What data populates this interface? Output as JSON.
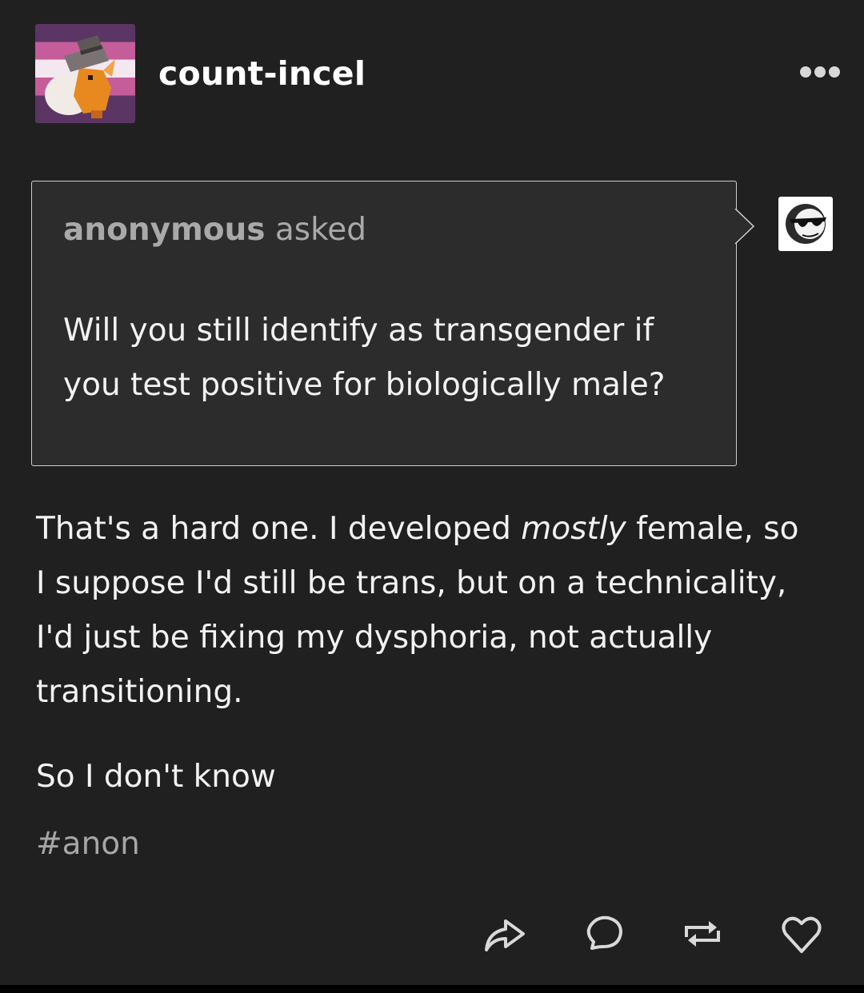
{
  "header": {
    "blog_name": "count-incel",
    "avatar_icon": "pixel-art-fox-with-hat-avatar",
    "more_icon": "more-dots-icon"
  },
  "ask": {
    "asker_name": "anonymous",
    "asked_label": "asked",
    "question_lines": [
      "Will you still identify as transgender if",
      "you test positive for biologically male?"
    ],
    "asker_avatar_icon": "sunglasses-face-icon"
  },
  "answer": {
    "line1_before": "That's a hard one. I developed ",
    "line1_emphasis": "mostly",
    "line1_after": " female, so",
    "line2": "I suppose I'd still be trans, but on a technicality,",
    "line3": "I'd just be fixing my dysphoria, not actually",
    "line4": "transitioning.",
    "paragraph2": "So I don't know"
  },
  "tags": [
    "#anon"
  ],
  "actions": {
    "share_icon": "share-icon",
    "reply_icon": "reply-bubble-icon",
    "reblog_icon": "reblog-icon",
    "like_icon": "heart-icon"
  },
  "colors": {
    "background": "#202020",
    "ask_background": "#2c2c2c",
    "text": "#f2f2f2",
    "muted": "#a9a9a9"
  }
}
